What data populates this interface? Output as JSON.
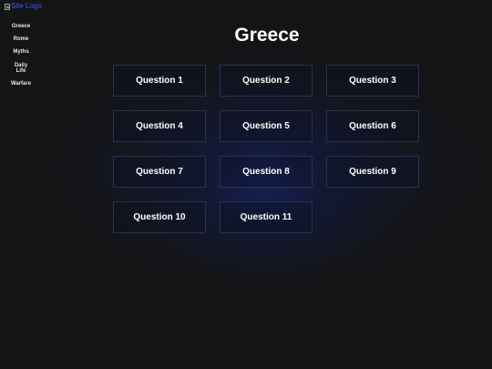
{
  "logo": {
    "alt_text": "Site Logo",
    "icon": "broken-image-icon"
  },
  "sidebar": {
    "items": [
      {
        "label": "Greece"
      },
      {
        "label": "Rome"
      },
      {
        "label": "Myths"
      },
      {
        "label": "Daily Life"
      },
      {
        "label": "Warfare"
      }
    ]
  },
  "main": {
    "title": "Greece",
    "questions": [
      {
        "label": "Question 1"
      },
      {
        "label": "Question 2"
      },
      {
        "label": "Question 3"
      },
      {
        "label": "Question 4"
      },
      {
        "label": "Question 5"
      },
      {
        "label": "Question 6"
      },
      {
        "label": "Question 7"
      },
      {
        "label": "Question 8"
      },
      {
        "label": "Question 9"
      },
      {
        "label": "Question 10"
      },
      {
        "label": "Question 11"
      }
    ]
  },
  "colors": {
    "background": "#141414",
    "glow": "#16225c",
    "card_border": "#2a3150",
    "text": "#ffffff",
    "link": "#3b57ff"
  }
}
